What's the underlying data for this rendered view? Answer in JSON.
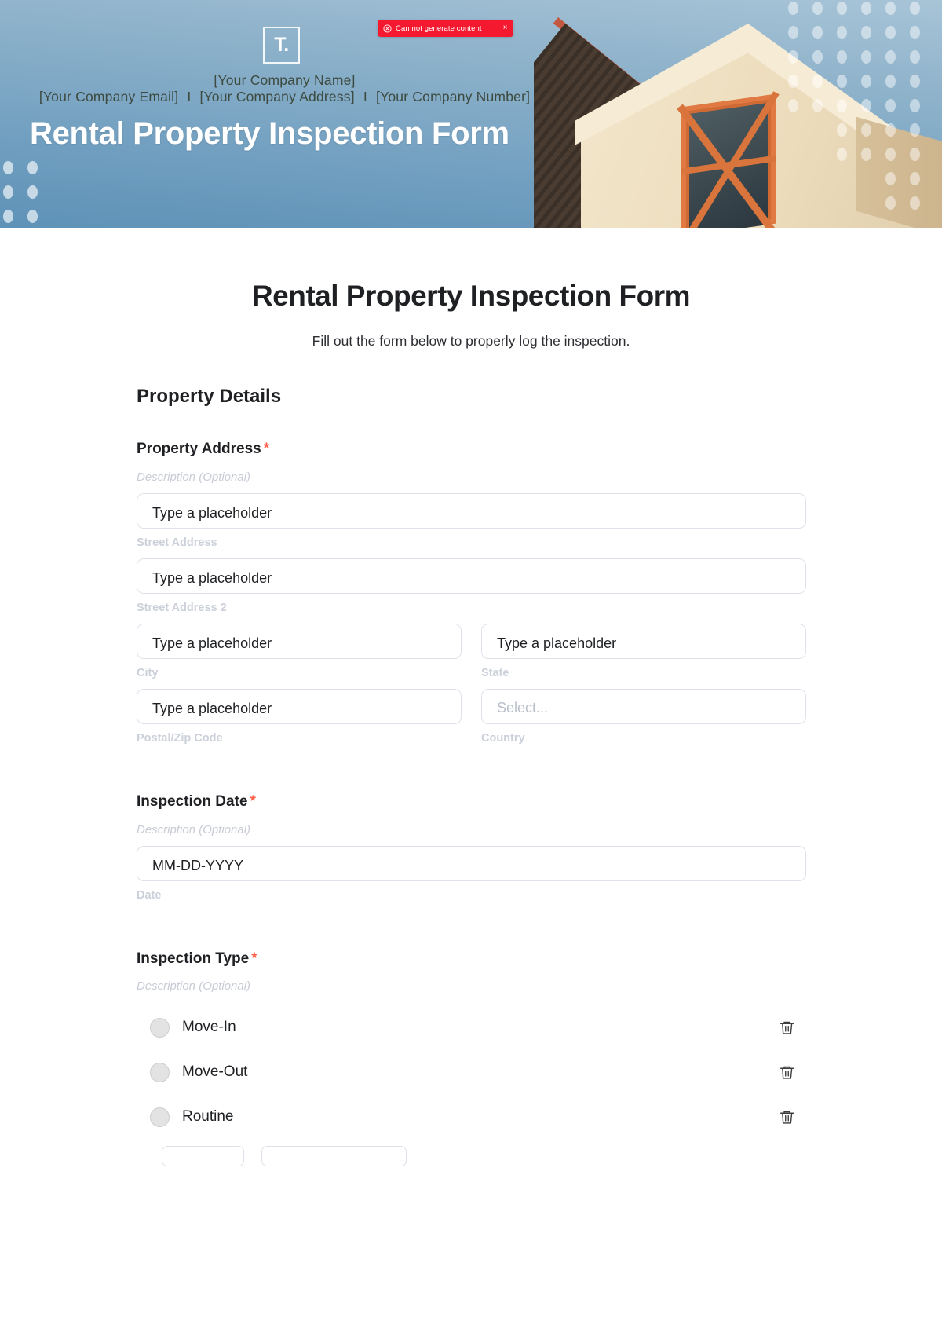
{
  "toast": {
    "message": "Can not generate content",
    "close_label": "×",
    "bg_color": "#f51930",
    "icon": "error-circle-icon"
  },
  "hero": {
    "logo_text": "T.",
    "company_name": "[Your Company Name]",
    "company_email": "[Your Company Email]",
    "company_address": "[Your Company Address]",
    "company_number": "[Your Company Number]",
    "separator": "I",
    "title": "Rental Property Inspection Form"
  },
  "form": {
    "title": "Rental Property Inspection Form",
    "subtitle": "Fill out the form below to properly log the inspection.",
    "required_mark": "*",
    "description_placeholder": "Description (Optional)",
    "section_title": "Property Details",
    "fields": [
      {
        "label": "Property Address",
        "required": true,
        "description": "Description (Optional)",
        "rows": [
          {
            "type": "single",
            "inputs": [
              {
                "value": "Type a placeholder",
                "sub_label": "Street Address",
                "kind": "text"
              }
            ]
          },
          {
            "type": "single",
            "inputs": [
              {
                "value": "Type a placeholder",
                "sub_label": "Street Address 2",
                "kind": "text"
              }
            ]
          },
          {
            "type": "double",
            "inputs": [
              {
                "value": "Type a placeholder",
                "sub_label": "City",
                "kind": "text"
              },
              {
                "value": "Type a placeholder",
                "sub_label": "State",
                "kind": "text"
              }
            ]
          },
          {
            "type": "double",
            "inputs": [
              {
                "value": "Type a placeholder",
                "sub_label": "Postal/Zip Code",
                "kind": "text"
              },
              {
                "value": "Select...",
                "sub_label": "Country",
                "kind": "select"
              }
            ]
          }
        ]
      },
      {
        "label": "Inspection Date",
        "required": true,
        "description": "Description (Optional)",
        "rows": [
          {
            "type": "single",
            "inputs": [
              {
                "value": "MM-DD-YYYY",
                "sub_label": "Date",
                "kind": "date"
              }
            ]
          }
        ]
      }
    ],
    "inspection_type": {
      "label": "Inspection Type",
      "required": true,
      "description": "Description (Optional)",
      "options": [
        {
          "label": "Move-In",
          "delete_icon": "trash-icon"
        },
        {
          "label": "Move-Out",
          "delete_icon": "trash-icon"
        },
        {
          "label": "Routine",
          "delete_icon": "trash-icon"
        }
      ]
    }
  },
  "colors": {
    "required_asterisk": "#ff5e47",
    "toast_bg": "#f51930",
    "sub_label": "#ccd0da",
    "border": "#dfe2ea",
    "heading": "#1f2023"
  }
}
